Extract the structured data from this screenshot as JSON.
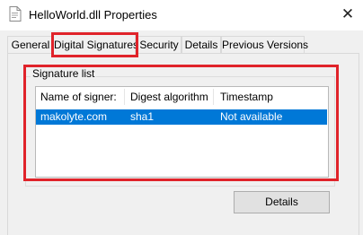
{
  "window": {
    "title": "HelloWorld.dll Properties",
    "close_glyph": "✕"
  },
  "tabs": [
    {
      "label": "General"
    },
    {
      "label": "Digital Signatures",
      "active": true
    },
    {
      "label": "Security"
    },
    {
      "label": "Details"
    },
    {
      "label": "Previous Versions"
    }
  ],
  "signature_group": {
    "label": "Signature list",
    "columns": [
      "Name of signer:",
      "Digest algorithm",
      "Timestamp"
    ],
    "rows": [
      {
        "signer": "makolyte.com",
        "digest": "sha1",
        "timestamp": "Not available",
        "selected": true
      }
    ]
  },
  "details_button": {
    "label": "Details"
  },
  "colors": {
    "selection": "#0078d7",
    "annotation_red": "#e0232a"
  }
}
